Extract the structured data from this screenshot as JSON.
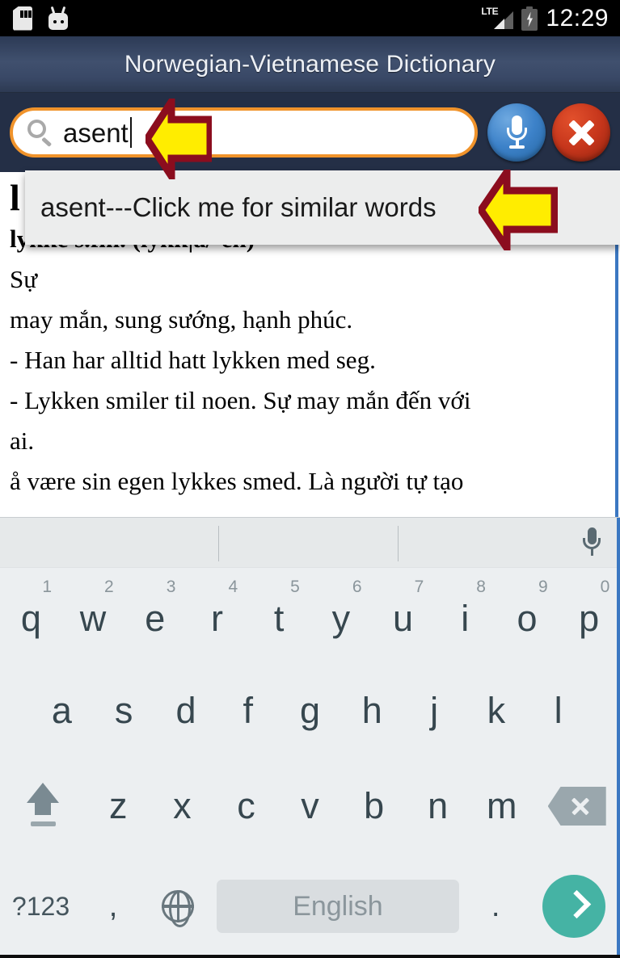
{
  "status_bar": {
    "icons": [
      "sd-card-icon",
      "android-robot-icon"
    ],
    "network": "LTE",
    "battery": "charging",
    "time": "12:29"
  },
  "header": {
    "title": "Norwegian-Vietnamese Dictionary"
  },
  "search": {
    "value": "asent",
    "placeholder": "",
    "search_icon": "magnifier-icon",
    "mic_icon": "microphone-icon",
    "close_icon": "close-x-icon",
    "border_color": "#f0932b"
  },
  "suggestion": {
    "text": "asent---Click me for similar words"
  },
  "annotations": [
    {
      "name": "arrow-pointing-at-search-text",
      "direction": "left",
      "fill": "#ffed00",
      "stroke": "#8b0d1e"
    },
    {
      "name": "arrow-pointing-at-suggestion",
      "direction": "left",
      "fill": "#ffed00",
      "stroke": "#8b0d1e"
    }
  ],
  "content": {
    "headword_behind_overlay": "l",
    "lines": [
      "lykke s.fm. (lykk|a/-en)",
      "Sự",
      "may mắn, sung sướng, hạnh phúc.",
      "- Han har alltid hatt lykken med seg.",
      "- Lykken smiler til noen. Sự may mắn đến với",
      "ai.",
      "å være sin egen lykkes smed. Là người tự tạo"
    ]
  },
  "keyboard": {
    "suggestion_strip_mic": "microphone-icon",
    "row1": [
      {
        "letter": "q",
        "num": "1"
      },
      {
        "letter": "w",
        "num": "2"
      },
      {
        "letter": "e",
        "num": "3"
      },
      {
        "letter": "r",
        "num": "4"
      },
      {
        "letter": "t",
        "num": "5"
      },
      {
        "letter": "y",
        "num": "6"
      },
      {
        "letter": "u",
        "num": "7"
      },
      {
        "letter": "i",
        "num": "8"
      },
      {
        "letter": "o",
        "num": "9"
      },
      {
        "letter": "p",
        "num": "0"
      }
    ],
    "row2": [
      "a",
      "s",
      "d",
      "f",
      "g",
      "h",
      "j",
      "k",
      "l"
    ],
    "row3": [
      "z",
      "x",
      "c",
      "v",
      "b",
      "n",
      "m"
    ],
    "shift_key": "shift-icon",
    "backspace_key": "backspace-icon",
    "symbols_key": "?123",
    "comma_key": ",",
    "globe_key": "globe-icon",
    "space_key": "English",
    "period_key": ".",
    "enter_key": "chevron-right-icon",
    "enter_color": "#45b3a4"
  }
}
